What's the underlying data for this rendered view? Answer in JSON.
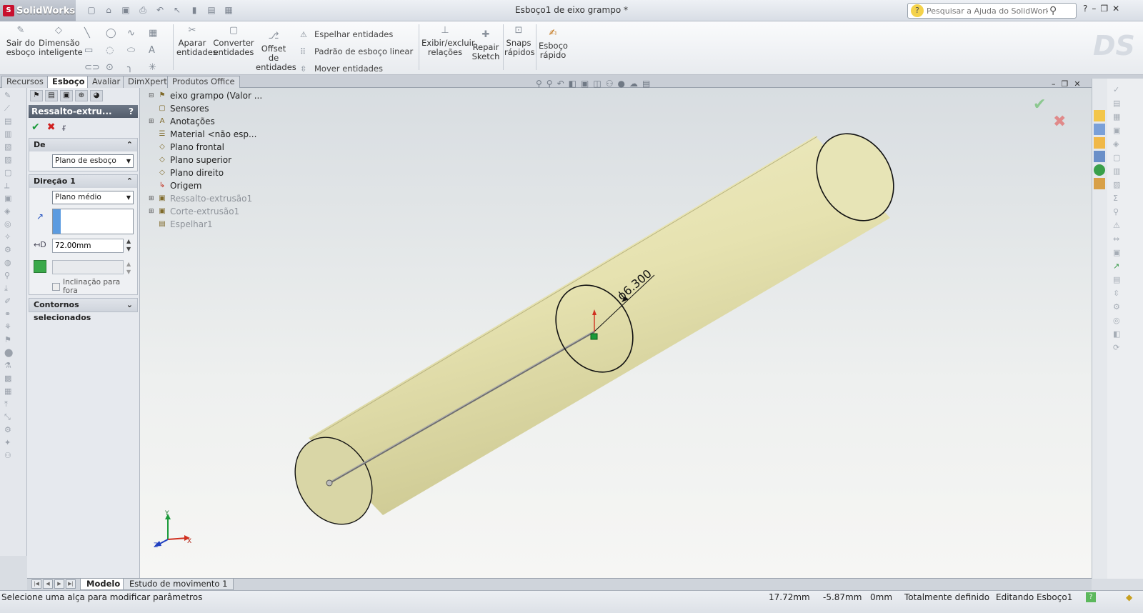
{
  "app": {
    "brand": "SolidWorks",
    "window_title": "Esboço1 de eixo grampo *",
    "search_placeholder": "Pesquisar a Ajuda do SolidWorks"
  },
  "commands": {
    "exit_sketch": "Sair do esboço",
    "smart_dimension": "Dimensão inteligente",
    "trim": "Aparar entidades",
    "convert": "Converter entidades",
    "offset": "Offset de entidades",
    "mirror": "Espelhar entidades",
    "linear_pattern": "Padrão de esboço linear",
    "move": "Mover entidades",
    "relations": "Exibir/excluir relações",
    "repair": "Repair Sketch",
    "snaps": "Snaps rápidos",
    "rapid_sketch": "Esboço rápido"
  },
  "tabs": [
    "Recursos",
    "Esboço",
    "Avaliar",
    "DimXpert",
    "Produtos Office"
  ],
  "property_manager": {
    "title": "Ressalto-extru...",
    "help": "?",
    "group_from": {
      "label": "De",
      "value": "Plano de esboço"
    },
    "group_dir1": {
      "label": "Direção 1",
      "end_condition": "Plano médio",
      "depth": "72.00mm",
      "draft_label": "Inclinação para fora"
    },
    "group_contours": {
      "label": "Contornos selecionados"
    }
  },
  "feature_tree": [
    {
      "label": "eixo grampo  (Valor ...",
      "dim": false
    },
    {
      "label": "Sensores",
      "dim": false
    },
    {
      "label": "Anotações",
      "dim": false
    },
    {
      "label": "Material <não esp...",
      "dim": false
    },
    {
      "label": "Plano frontal",
      "dim": false
    },
    {
      "label": "Plano superior",
      "dim": false
    },
    {
      "label": "Plano direito",
      "dim": false
    },
    {
      "label": "Origem",
      "dim": false
    },
    {
      "label": "Ressalto-extrusão1",
      "dim": true
    },
    {
      "label": "Corte-extrusão1",
      "dim": true
    },
    {
      "label": "Espelhar1",
      "dim": true
    }
  ],
  "viewport": {
    "dimension_label": "ϕ6.300",
    "axis_x": "X",
    "axis_y": "Y",
    "axis_z": "Z",
    "colors": {
      "cylinder": "#e8e4b4",
      "cylinder_shade": "#c6c28a",
      "end_face": "#dedbae",
      "axis_red": "#d03020",
      "axis_green": "#1a9a3a",
      "axis_blue": "#2040c0"
    }
  },
  "bottom_tabs": [
    "Modelo",
    "Estudo de movimento 1"
  ],
  "status": {
    "message": "Selecione uma alça para modificar parâmetros",
    "x": "17.72mm",
    "y": "-5.87mm",
    "z": "0mm",
    "state": "Totalmente definido",
    "mode": "Editando Esboço1"
  }
}
